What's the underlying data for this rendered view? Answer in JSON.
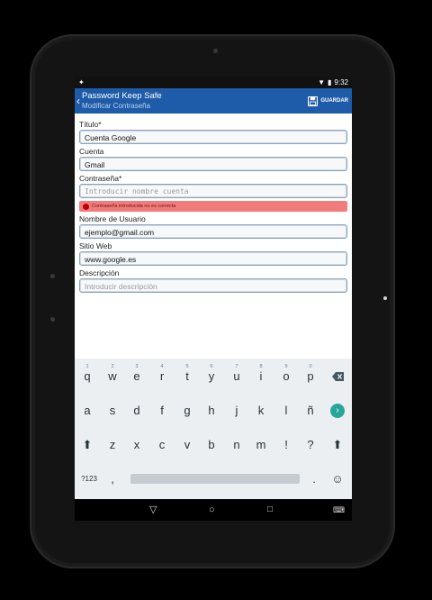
{
  "status": {
    "time": "9:32"
  },
  "app": {
    "title": "Password Keep Safe",
    "subtitle": "Modificar Contraseña",
    "save_label": "GUARDAR"
  },
  "form": {
    "title_label": "Título*",
    "title_value": "Cuenta Google",
    "account_label": "Cuenta",
    "account_value": "Gmail",
    "password_label": "Contraseña*",
    "password_placeholder": "Introducir nombre cuenta",
    "password_error": "Contraseña introducida no es correcta",
    "username_label": "Nombre de Usuario",
    "username_value": "ejemplo@gmail.com",
    "website_label": "Sitio Web",
    "website_value": "www.google.es",
    "description_label": "Descripción",
    "description_placeholder": "Introducir descripción"
  },
  "keyboard": {
    "row1": [
      "q",
      "w",
      "e",
      "r",
      "t",
      "y",
      "u",
      "i",
      "o",
      "p"
    ],
    "row1_hints": [
      "1",
      "2",
      "3",
      "4",
      "5",
      "6",
      "7",
      "8",
      "9",
      "0"
    ],
    "row2": [
      "a",
      "s",
      "d",
      "f",
      "g",
      "h",
      "j",
      "k",
      "l",
      "ñ"
    ],
    "row3": [
      "z",
      "x",
      "c",
      "v",
      "b",
      "n",
      "m",
      "!",
      "?"
    ],
    "symbols_label": "?123",
    "comma": ",",
    "period": ".",
    "emoji": "☺"
  },
  "colors": {
    "appbar": "#1e5ba8",
    "error_bg": "#f27c7c",
    "go_key": "#26a69a"
  }
}
